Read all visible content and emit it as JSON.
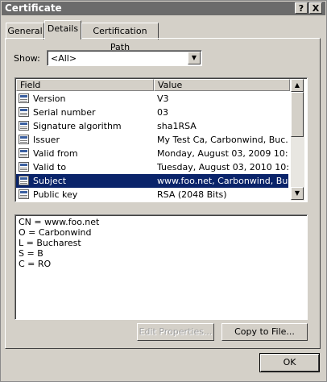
{
  "window": {
    "title": "Certificate",
    "help_btn": "?",
    "close_btn": "X"
  },
  "tabs": [
    {
      "label": "General"
    },
    {
      "label": "Details"
    },
    {
      "label": "Certification Path"
    }
  ],
  "show": {
    "label": "Show:",
    "value": "<All>"
  },
  "list": {
    "columns": [
      "Field",
      "Value"
    ],
    "rows": [
      {
        "field": "Version",
        "value": "V3"
      },
      {
        "field": "Serial number",
        "value": "03"
      },
      {
        "field": "Signature algorithm",
        "value": "sha1RSA"
      },
      {
        "field": "Issuer",
        "value": "My Test Ca, Carbonwind, Buc..."
      },
      {
        "field": "Valid from",
        "value": "Monday, August 03, 2009 10:..."
      },
      {
        "field": "Valid to",
        "value": "Tuesday, August 03, 2010 10:..."
      },
      {
        "field": "Subject",
        "value": "www.foo.net, Carbonwind, Bu..."
      },
      {
        "field": "Public key",
        "value": "RSA (2048 Bits)"
      }
    ],
    "selected_index": 6
  },
  "details": [
    "CN = www.foo.net",
    "O = Carbonwind",
    "L = Bucharest",
    "S = B",
    "C = RO"
  ],
  "buttons": {
    "edit_properties": "Edit Properties...",
    "copy_to_file": "Copy to File...",
    "ok": "OK"
  },
  "colors": {
    "selection": "#0a246a",
    "face": "#d4d0c8",
    "titlebar": "#6b6b6b"
  }
}
